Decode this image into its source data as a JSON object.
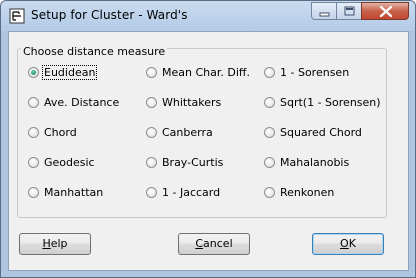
{
  "window": {
    "title": "Setup for Cluster - Ward's",
    "icons": [
      "app-icon",
      "minimize-icon",
      "maximize-icon",
      "close-icon"
    ]
  },
  "group": {
    "label": "Choose distance measure"
  },
  "options": {
    "col1": [
      "Eudidean",
      "Ave. Distance",
      "Chord",
      "Geodesic",
      "Manhattan"
    ],
    "col2": [
      "Mean Char. Diff.",
      "Whittakers",
      "Canberra",
      "Bray-Curtis",
      "1 - Jaccard"
    ],
    "col3": [
      "1 - Sorensen",
      "Sqrt(1 - Sorensen)",
      "Squared Chord",
      "Mahalanobis",
      "Renkonen"
    ],
    "selected": "Eudidean"
  },
  "buttons": {
    "help": {
      "mnemonic": "H",
      "rest": "elp"
    },
    "cancel": {
      "mnemonic": "C",
      "rest": "ancel"
    },
    "ok": {
      "mnemonic": "O",
      "rest": "K"
    }
  },
  "colors": {
    "frame": "#aec6e2",
    "close_button": "#c8614a",
    "selected_radio": "#1a7a50"
  }
}
